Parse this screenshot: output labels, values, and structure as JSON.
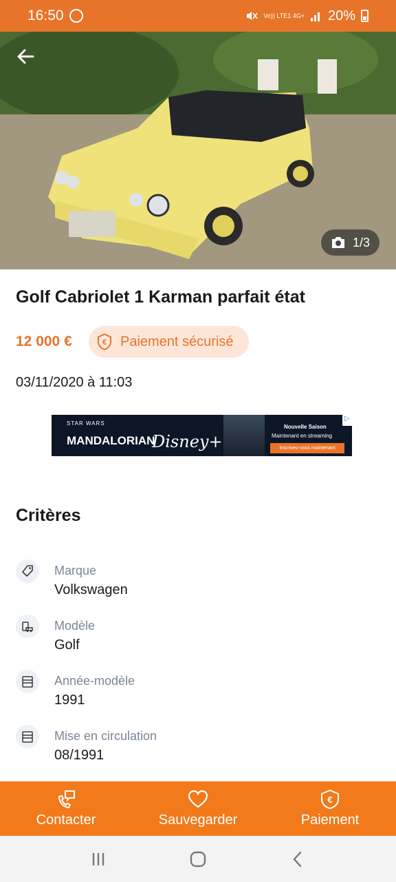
{
  "status_bar": {
    "time": "16:50",
    "network": "Vo)) LTE1 4G+",
    "battery": "20%"
  },
  "hero": {
    "image_counter": "1/3"
  },
  "listing": {
    "title": "Golf Cabriolet 1 Karman parfait état",
    "price": "12 000 €",
    "secure_badge": "Paiement sécurisé",
    "date": "03/11/2020 à 11:03"
  },
  "ad": {
    "brand_small": "STAR WARS",
    "brand": "MANDALORIAN",
    "network": "Disney+",
    "headline": "Nouvelle Saison",
    "sub": "Maintenant en streaming",
    "cta": "Inscrivez-vous maintenant"
  },
  "criteria": {
    "heading": "Critères",
    "items": [
      {
        "label": "Marque",
        "value": "Volkswagen",
        "icon": "tag-icon"
      },
      {
        "label": "Modèle",
        "value": "Golf",
        "icon": "car-icon"
      },
      {
        "label": "Année-modèle",
        "value": "1991",
        "icon": "calendar-icon"
      },
      {
        "label": "Mise en circulation",
        "value": "08/1991",
        "icon": "calendar-icon"
      }
    ]
  },
  "actions": {
    "contact": "Contacter",
    "save": "Sauvegarder",
    "payment": "Paiement"
  },
  "colors": {
    "accent": "#f27a1a",
    "status_bar": "#e8742a",
    "badge_bg": "#fde6d8"
  }
}
